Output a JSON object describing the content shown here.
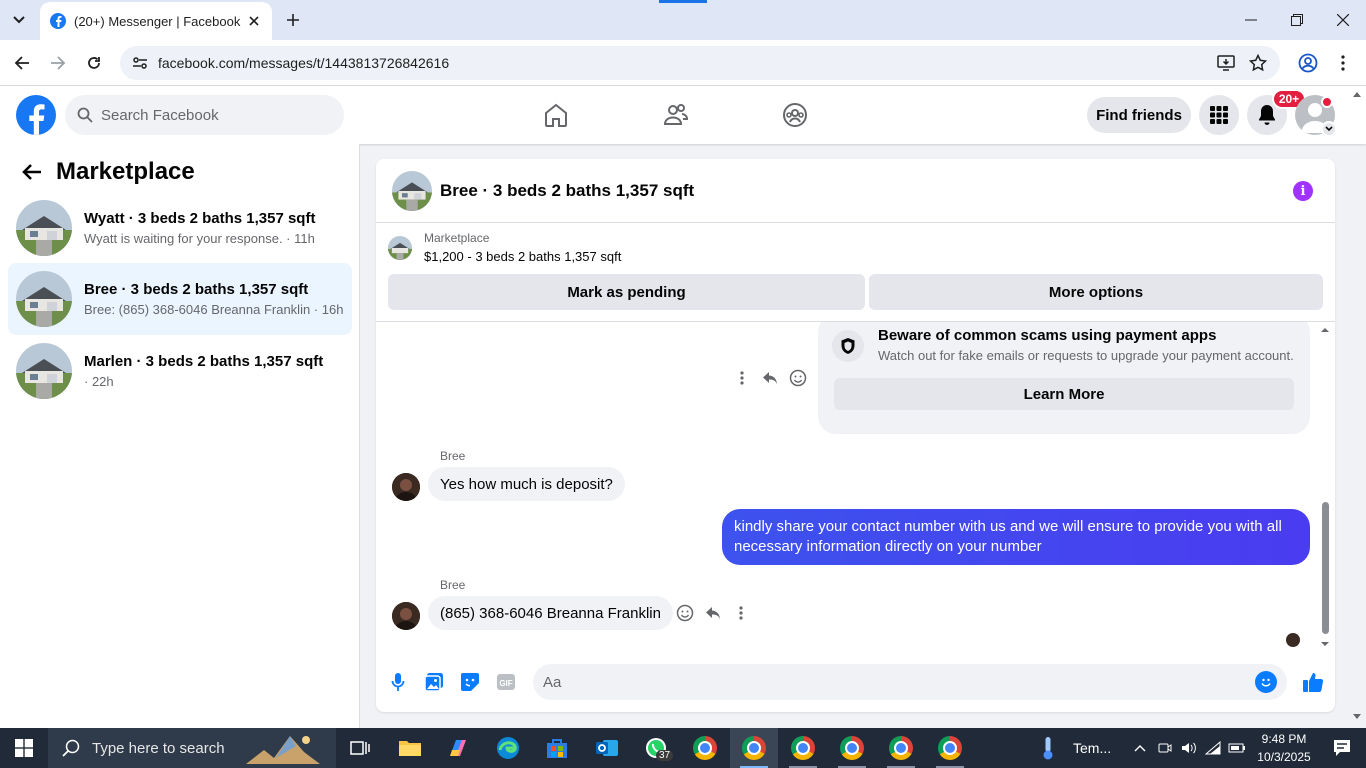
{
  "browser": {
    "tab_title": "(20+) Messenger | Facebook",
    "url": "facebook.com/messages/t/1443813726842616"
  },
  "fb": {
    "search_placeholder": "Search Facebook",
    "find_friends": "Find friends",
    "notif_badge": "20+"
  },
  "sidebar": {
    "title": "Marketplace",
    "conversations": [
      {
        "title": "Wyatt · 3 beds 2 baths 1,357 sqft",
        "subtitle": "Wyatt is waiting for your response. · 11h",
        "active": false
      },
      {
        "title": "Bree · 3 beds 2 baths 1,357 sqft",
        "subtitle": "Bree: (865) 368-6046 Breanna Franklin · 16h",
        "active": true
      },
      {
        "title": "Marlen · 3 beds 2 baths 1,357 sqft",
        "subtitle": "· 22h",
        "active": false
      }
    ]
  },
  "chat": {
    "title": "Bree · 3 beds 2 baths 1,357 sqft",
    "marketplace_label": "Marketplace",
    "listing": "$1,200 - 3 beds 2 baths 1,357 sqft",
    "mark_pending": "Mark as pending",
    "more_options": "More options",
    "scam_title": "Beware of common scams using payment apps",
    "scam_sub": "Watch out for fake emails or requests to upgrade your payment account.",
    "learn_more": "Learn More",
    "messages": [
      {
        "sender": "Bree",
        "text": "Yes how much is deposit?"
      },
      {
        "sender": "me",
        "text": "kindly share your contact number with us and we will ensure to provide you with all necessary information directly on your number"
      },
      {
        "sender": "Bree",
        "text": "(865) 368-6046 Breanna Franklin"
      }
    ],
    "input_placeholder": "Aa"
  },
  "taskbar": {
    "search_placeholder": "Type here to search",
    "weather": "Tem...",
    "whatsapp_count": "37",
    "time": "9:48 PM",
    "date": "10/3/2025"
  },
  "colors": {
    "fb_blue": "#1877f2",
    "outgoing_bubble": "#3d52ee",
    "info_purple": "#a033ff",
    "badge_red": "#e41e3f"
  }
}
